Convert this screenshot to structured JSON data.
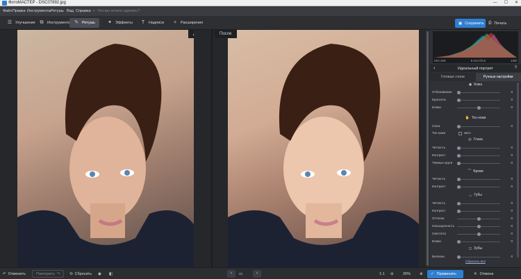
{
  "window": {
    "title": "ФотоМАСТЕР - DSC07892.jpg",
    "minimize": "—",
    "maximize": "☐",
    "close": "✕"
  },
  "menu": {
    "items": [
      "Файл",
      "Правка",
      "Инструменты",
      "Ретушь",
      "Вид",
      "Справка"
    ],
    "search_placeholder": "Что вы хотите сделать?"
  },
  "toolbar": {
    "tabs": [
      "Улучшения",
      "Инструменты",
      "Ретушь",
      "Эффекты",
      "Надписи",
      "Расширения"
    ],
    "active_tab": "Ретушь",
    "save_label": "Сохранить",
    "print_label": "Печать"
  },
  "canvas": {
    "before_label": "До",
    "after_label": "После"
  },
  "histogram": {
    "iso": "ISO 200",
    "exposure": "5 mm f/2.8",
    "shutter": "1/80"
  },
  "panel": {
    "title": "Идеальный портрет",
    "tabs": [
      "Готовые стили",
      "Ручные настройки"
    ],
    "active_tab": "Ручные настройки",
    "sections": {
      "skin": "Кожа",
      "skin_tone": "Тон кожи",
      "eyes": "Глаза",
      "brows": "Брови",
      "lips": "Губы",
      "teeth": "Зубы"
    },
    "sliders": [
      {
        "label": "Отбеливание",
        "value": "0",
        "level": 0.0
      },
      {
        "label": "Краснота",
        "value": "0",
        "level": 0.0
      },
      {
        "label": "Блики",
        "value": "0",
        "level": 0.5
      },
      {
        "label": "Сила",
        "value": "0",
        "level": 0.0
      },
      {
        "label": "Чёткость",
        "value": "0",
        "level": 0.0
      },
      {
        "label": "Контраст",
        "value": "0",
        "level": 0.0
      },
      {
        "label": "Тёмные круги",
        "value": "0",
        "level": 0.0
      },
      {
        "label": "Чёткость",
        "value": "0",
        "level": 0.0
      },
      {
        "label": "Контраст",
        "value": "0",
        "level": 0.0
      },
      {
        "label": "Чёткость",
        "value": "0",
        "level": 0.0
      },
      {
        "label": "Контраст",
        "value": "0",
        "level": 0.0
      },
      {
        "label": "Оттенок",
        "value": "0",
        "level": 0.5
      },
      {
        "label": "Насыщенность",
        "value": "0",
        "level": 0.5
      },
      {
        "label": "Светлота",
        "value": "0",
        "level": 0.5
      },
      {
        "label": "Блики",
        "value": "0",
        "level": 0.0
      },
      {
        "label": "Белизна",
        "value": "0",
        "level": 0.0
      }
    ],
    "skin_tone_row": {
      "label": "Тон кожи",
      "check": "авто"
    },
    "reset_all": "Сбросить всё"
  },
  "status": {
    "undo": "Отменить",
    "redo": "Повторить",
    "reset": "Сбросить",
    "ratio": "1:1",
    "zoom": "26%",
    "apply": "Применить",
    "cancel": "Отмена"
  },
  "colors": {
    "accent": "#2f7fd0",
    "panel_bg": "#2f3136",
    "toolbar_bg": "#2d2f33"
  }
}
